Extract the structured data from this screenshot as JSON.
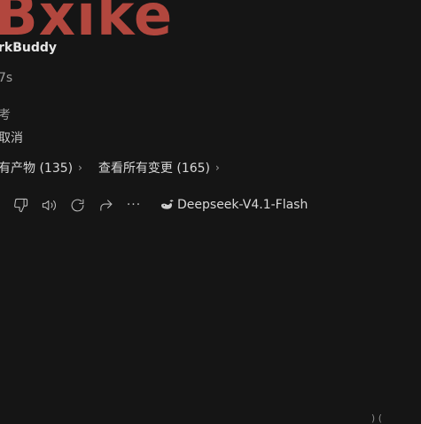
{
  "brand": {
    "logo_text": "Bxike",
    "logo_color": "#b2473e"
  },
  "message": {
    "bot_name": "rkBuddy",
    "duration": "7s",
    "line_a": "考",
    "line_b": "取消"
  },
  "links": [
    {
      "label": "有产物 (135)",
      "icon": "chevron-right-icon"
    },
    {
      "label": "查看所有变更 (165)",
      "icon": "chevron-right-icon"
    }
  ],
  "toolbar": {
    "buttons": [
      {
        "name": "thumbs-down-icon"
      },
      {
        "name": "speaker-icon"
      },
      {
        "name": "refresh-icon"
      },
      {
        "name": "share-icon"
      }
    ],
    "more_label": "···",
    "model_label": "Deepseek-V4.1-Flash",
    "model_icon": "whale-icon"
  },
  "corner_text": ")  ("
}
